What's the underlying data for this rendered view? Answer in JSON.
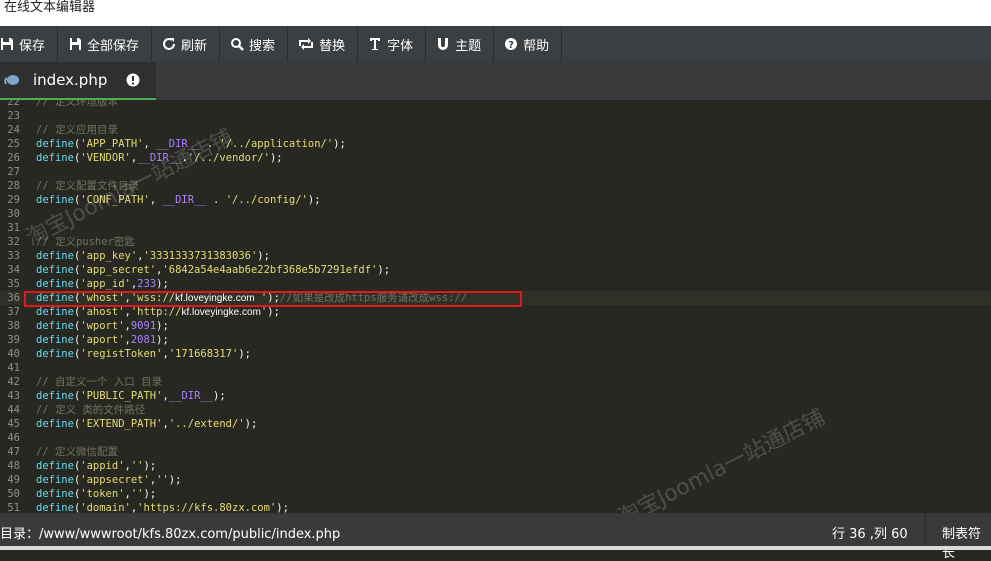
{
  "window": {
    "title": "在线文本编辑器"
  },
  "toolbar": {
    "buttons": [
      {
        "label": "保存",
        "icon": "save-icon"
      },
      {
        "label": "全部保存",
        "icon": "save-all-icon"
      },
      {
        "label": "刷新",
        "icon": "refresh-icon"
      },
      {
        "label": "搜索",
        "icon": "search-icon"
      },
      {
        "label": "替换",
        "icon": "replace-icon"
      },
      {
        "label": "字体",
        "icon": "font-icon"
      },
      {
        "label": "主题",
        "icon": "theme-icon"
      },
      {
        "label": "帮助",
        "icon": "help-icon"
      }
    ]
  },
  "tabs": [
    {
      "name": "index.php",
      "icon": "php-elephant-icon",
      "badge_icon": "info-icon"
    }
  ],
  "editor": {
    "active_line": 36,
    "lines": [
      {
        "n": "22",
        "t": [
          [
            "c-cm",
            "// 定义环境版本"
          ]
        ]
      },
      {
        "n": "23",
        "t": []
      },
      {
        "n": "24",
        "t": [
          [
            "c-cm",
            "// 定义应用目录"
          ]
        ]
      },
      {
        "n": "25",
        "t": [
          [
            "c-fn",
            "define"
          ],
          [
            "",
            "("
          ],
          [
            "c-str",
            "'APP_PATH'"
          ],
          [
            "",
            ", "
          ],
          [
            "c-const",
            "__DIR__"
          ],
          [
            "",
            " . "
          ],
          [
            "c-str",
            "'/../application/'"
          ],
          [
            "",
            ");"
          ]
        ]
      },
      {
        "n": "26",
        "t": [
          [
            "c-fn",
            "define"
          ],
          [
            "",
            "("
          ],
          [
            "c-str",
            "'VENDOR'"
          ],
          [
            "",
            ","
          ],
          [
            "c-const",
            "__DIR__"
          ],
          [
            "",
            "."
          ],
          [
            "c-str",
            "'/../vendor/'"
          ],
          [
            "",
            ");"
          ]
        ]
      },
      {
        "n": "27",
        "t": []
      },
      {
        "n": "28",
        "t": [
          [
            "c-cm",
            "// 定义配置文件目录"
          ]
        ]
      },
      {
        "n": "29",
        "t": [
          [
            "c-fn",
            "define"
          ],
          [
            "",
            "("
          ],
          [
            "c-str",
            "'CONF_PATH'"
          ],
          [
            "",
            ", "
          ],
          [
            "c-const",
            "__DIR__"
          ],
          [
            "",
            " . "
          ],
          [
            "c-str",
            "'/../config/'"
          ],
          [
            "",
            ");"
          ]
        ]
      },
      {
        "n": "30",
        "t": []
      },
      {
        "n": "31",
        "t": []
      },
      {
        "n": "32",
        "t": [
          [
            "c-cm",
            "// 定义pusher密匙"
          ]
        ]
      },
      {
        "n": "33",
        "t": [
          [
            "c-fn",
            "define"
          ],
          [
            "",
            "("
          ],
          [
            "c-str",
            "'app_key'"
          ],
          [
            "",
            ","
          ],
          [
            "c-str",
            "'3331333731383036'"
          ],
          [
            "",
            ");"
          ]
        ]
      },
      {
        "n": "34",
        "t": [
          [
            "c-fn",
            "define"
          ],
          [
            "",
            "("
          ],
          [
            "c-str",
            "'app_secret'"
          ],
          [
            "",
            ","
          ],
          [
            "c-str",
            "'6842a54e4aab6e22bf368e5b7291efdf'"
          ],
          [
            "",
            ");"
          ]
        ]
      },
      {
        "n": "35",
        "t": [
          [
            "c-fn",
            "define"
          ],
          [
            "",
            "("
          ],
          [
            "c-str",
            "'app_id'"
          ],
          [
            "",
            ","
          ],
          [
            "c-const",
            "233"
          ],
          [
            "",
            ");"
          ]
        ]
      },
      {
        "n": "36",
        "t": [
          [
            "c-fn",
            "define"
          ],
          [
            "",
            "("
          ],
          [
            "c-str",
            "'whost'"
          ],
          [
            "",
            ","
          ],
          [
            "c-str",
            "'wss://"
          ],
          [
            "c-url",
            "kf.loveyingke.com"
          ],
          [
            "c-str",
            " '"
          ],
          [
            "",
            ");"
          ],
          [
            "c-cm",
            "//如果是改成https服务请改成wss://"
          ]
        ]
      },
      {
        "n": "37",
        "t": [
          [
            "c-fn",
            "define"
          ],
          [
            "",
            "("
          ],
          [
            "c-str",
            "'ahost'"
          ],
          [
            "",
            ","
          ],
          [
            "c-str",
            "'http://"
          ],
          [
            "c-url",
            "kf.loveyingke.com"
          ],
          [
            "c-str",
            "'"
          ],
          [
            "",
            ");"
          ]
        ]
      },
      {
        "n": "38",
        "t": [
          [
            "c-fn",
            "define"
          ],
          [
            "",
            "("
          ],
          [
            "c-str",
            "'wport'"
          ],
          [
            "",
            ","
          ],
          [
            "c-const",
            "9091"
          ],
          [
            "",
            ");"
          ]
        ]
      },
      {
        "n": "39",
        "t": [
          [
            "c-fn",
            "define"
          ],
          [
            "",
            "("
          ],
          [
            "c-str",
            "'aport'"
          ],
          [
            "",
            ","
          ],
          [
            "c-const",
            "2081"
          ],
          [
            "",
            ");"
          ]
        ]
      },
      {
        "n": "40",
        "t": [
          [
            "c-fn",
            "define"
          ],
          [
            "",
            "("
          ],
          [
            "c-str",
            "'registToken'"
          ],
          [
            "",
            ","
          ],
          [
            "c-str",
            "'171668317'"
          ],
          [
            "",
            ");"
          ]
        ]
      },
      {
        "n": "41",
        "t": []
      },
      {
        "n": "42",
        "t": [
          [
            "c-cm",
            "// 自定义一个 入口 目录"
          ]
        ]
      },
      {
        "n": "43",
        "t": [
          [
            "c-fn",
            "define"
          ],
          [
            "",
            "("
          ],
          [
            "c-str",
            "'PUBLIC_PATH'"
          ],
          [
            "",
            ","
          ],
          [
            "c-const",
            "__DIR__"
          ],
          [
            "",
            ");"
          ]
        ]
      },
      {
        "n": "44",
        "t": [
          [
            "c-cm",
            "// 定义 类的文件路径"
          ]
        ]
      },
      {
        "n": "45",
        "t": [
          [
            "c-fn",
            "define"
          ],
          [
            "",
            "("
          ],
          [
            "c-str",
            "'EXTEND_PATH'"
          ],
          [
            "",
            ","
          ],
          [
            "c-str",
            "'../extend/'"
          ],
          [
            "",
            ");"
          ]
        ]
      },
      {
        "n": "46",
        "t": []
      },
      {
        "n": "47",
        "t": [
          [
            "c-cm",
            "// 定义微信配置"
          ]
        ]
      },
      {
        "n": "48",
        "t": [
          [
            "c-fn",
            "define"
          ],
          [
            "",
            "("
          ],
          [
            "c-str",
            "'appid'"
          ],
          [
            "",
            ","
          ],
          [
            "c-str",
            "''"
          ],
          [
            "",
            ");"
          ]
        ]
      },
      {
        "n": "49",
        "t": [
          [
            "c-fn",
            "define"
          ],
          [
            "",
            "("
          ],
          [
            "c-str",
            "'appsecret'"
          ],
          [
            "",
            ","
          ],
          [
            "c-str",
            "''"
          ],
          [
            "",
            ");"
          ]
        ]
      },
      {
        "n": "50",
        "t": [
          [
            "c-fn",
            "define"
          ],
          [
            "",
            "("
          ],
          [
            "c-str",
            "'token'"
          ],
          [
            "",
            ","
          ],
          [
            "c-str",
            "''"
          ],
          [
            "",
            ");"
          ]
        ]
      },
      {
        "n": "51",
        "t": [
          [
            "c-fn",
            "define"
          ],
          [
            "",
            "("
          ],
          [
            "c-str",
            "'domain'"
          ],
          [
            "",
            ","
          ],
          [
            "c-str",
            "'https://kfs.80zx.com'"
          ],
          [
            "",
            ");"
          ]
        ]
      }
    ]
  },
  "watermarks": [
    "淘宝Joomla一站通店铺",
    "淘宝Joomla一站通店铺"
  ],
  "statusbar": {
    "path": "目录：/www/wwwroot/kfs.80zx.com/public/index.php",
    "position": "行 36 ,列 60",
    "indent": "制表符长"
  },
  "colors": {
    "background": "#272822",
    "toolbar": "#3c3f41",
    "tab_accent": "#4caf50",
    "highlight_box": "#e0191b"
  }
}
